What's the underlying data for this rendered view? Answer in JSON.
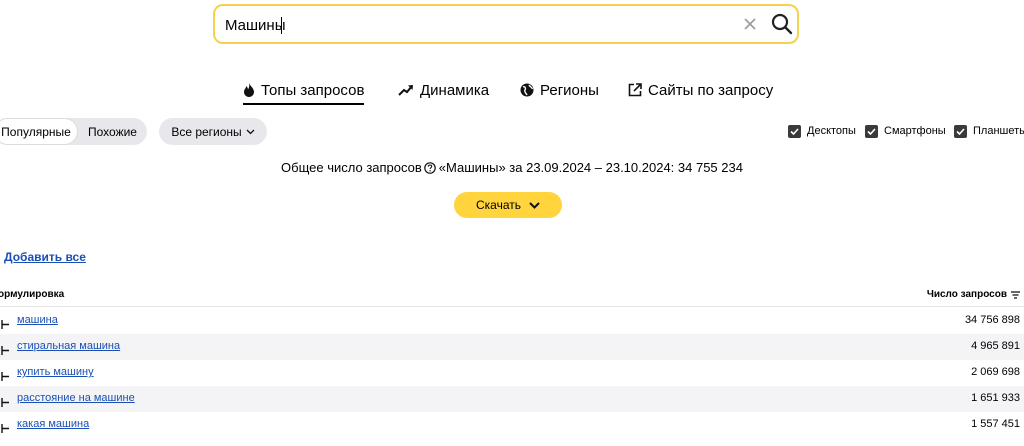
{
  "search": {
    "value": "Машины"
  },
  "tabs": [
    {
      "label": "Топы запросов",
      "icon": "fire-icon",
      "active": true
    },
    {
      "label": "Динамика",
      "icon": "trend-icon",
      "active": false
    },
    {
      "label": "Регионы",
      "icon": "globe-icon",
      "active": false
    },
    {
      "label": "Сайты по запросу",
      "icon": "external-link-icon",
      "active": false
    }
  ],
  "filters": {
    "popular_label": "Популярные",
    "similar_label": "Похожие",
    "regions_label": "Все регионы",
    "devices": [
      {
        "label": "Десктопы",
        "checked": true
      },
      {
        "label": "Смартфоны",
        "checked": true
      },
      {
        "label": "Планшеты",
        "checked": true
      }
    ]
  },
  "summary": {
    "prefix": "Общее число запросов",
    "rest": "«Машины» за 23.09.2024 – 23.10.2024: 34 755 234"
  },
  "download_label": "Скачать",
  "add_all_label": "Добавить все",
  "table": {
    "col_phrase": "ормулировка",
    "col_count": "Число запросов",
    "rows": [
      {
        "phrase": "машина",
        "count": "34 756 898"
      },
      {
        "phrase": "стиральная машина",
        "count": "4 965 891"
      },
      {
        "phrase": "купить машину",
        "count": "2 069 698"
      },
      {
        "phrase": "расстояние на машине",
        "count": "1 651 933"
      },
      {
        "phrase": "какая машина",
        "count": "1 557 451"
      }
    ]
  },
  "colors": {
    "accent_yellow": "#ffd43c",
    "search_border": "#f5d24a",
    "link_blue": "#1a4fb5"
  }
}
